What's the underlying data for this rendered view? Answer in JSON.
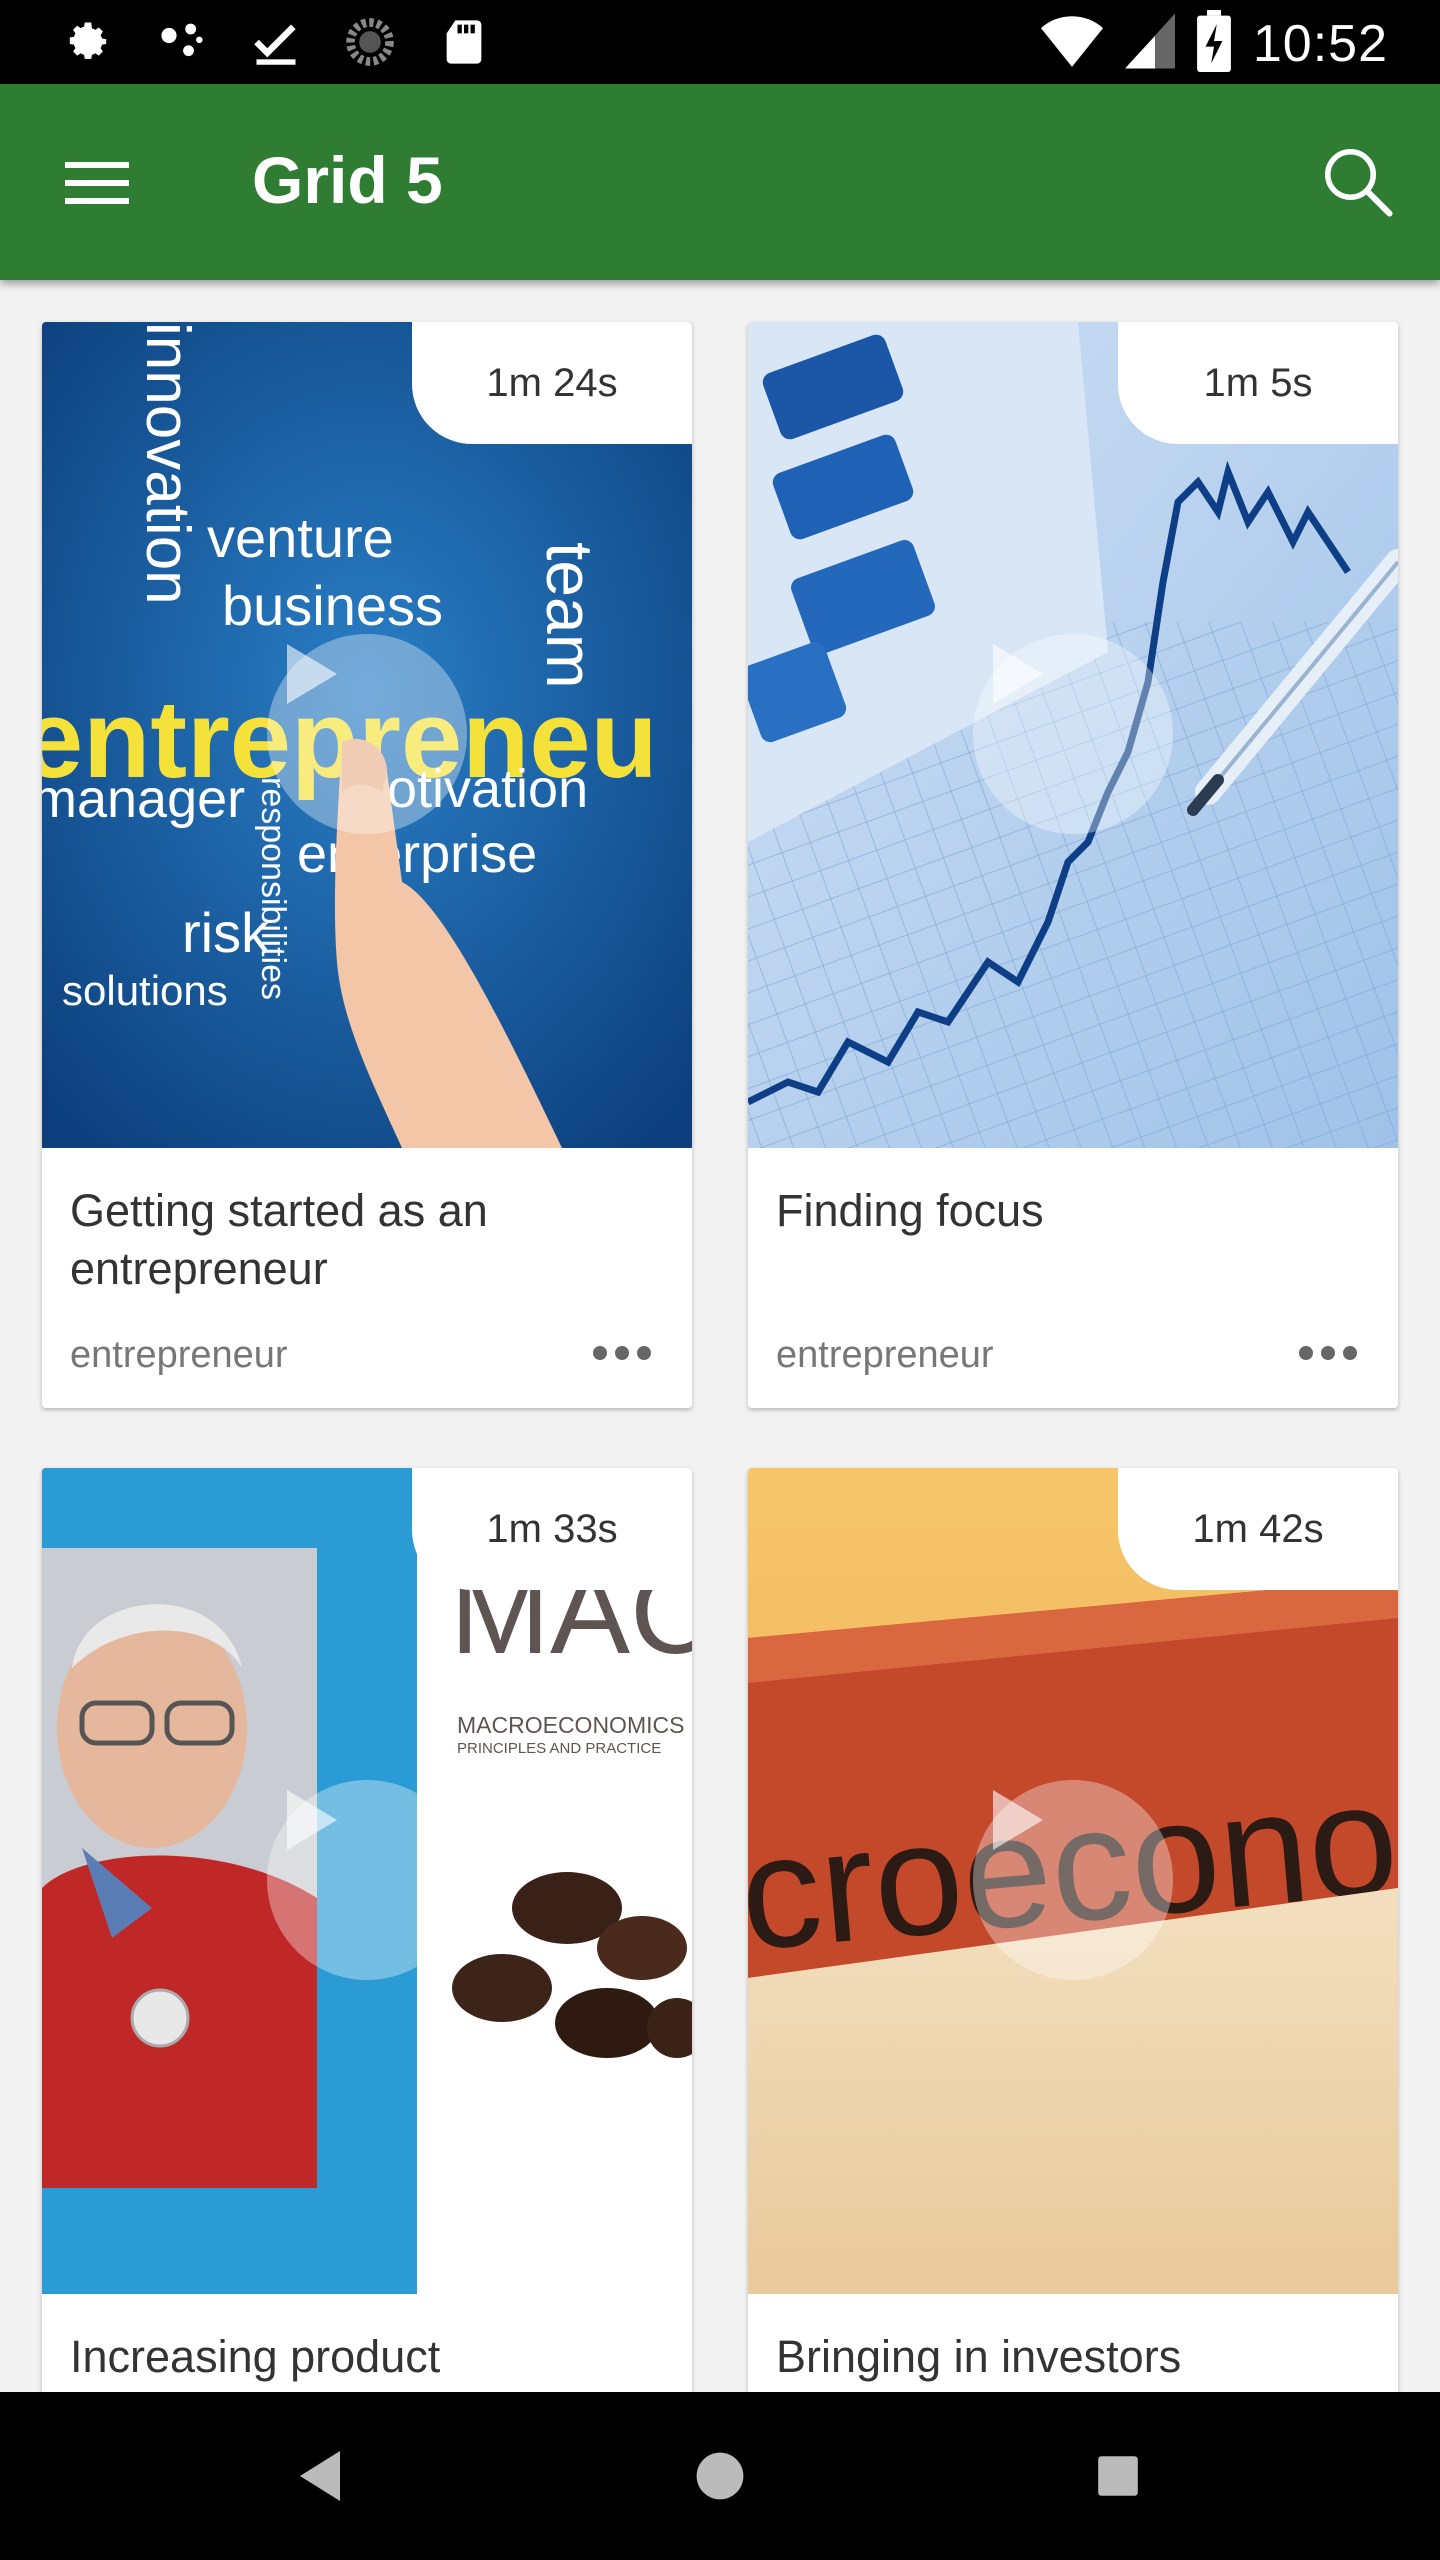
{
  "status_bar": {
    "time": "10:52",
    "left_icons": [
      "settings-icon",
      "dots-network-icon",
      "download-check-icon",
      "sync-spinner-icon",
      "sd-card-icon"
    ],
    "right_icons": [
      "wifi-icon",
      "cellular-signal-icon",
      "battery-charging-icon"
    ]
  },
  "app_bar": {
    "title": "Grid 5",
    "menu_icon": "hamburger-menu-icon",
    "search_icon": "search-icon"
  },
  "colors": {
    "app_bar": "#2e7d32",
    "background": "#f2f2f2",
    "card": "#ffffff"
  },
  "cards": [
    {
      "title": "Getting started as an entrepreneur",
      "tag": "entrepreneur",
      "duration": "1m 24s",
      "thumb_words": [
        "innovation",
        "venture",
        "business",
        "team",
        "entrepreneu",
        "manager",
        "motivation",
        "enterprise",
        "risk",
        "solutions",
        "responsibilities"
      ]
    },
    {
      "title": "Finding focus",
      "tag": "entrepreneur",
      "duration": "1m 5s",
      "thumb_words": []
    },
    {
      "title": "Increasing product",
      "tag": "",
      "duration": "1m 33s",
      "thumb_words": [
        "MAC",
        "MACROECONOMICS",
        "PRINCIPLES AND PRACTICE"
      ]
    },
    {
      "title": "Bringing in investors",
      "tag": "",
      "duration": "1m 42s",
      "thumb_words": [
        "croeconom"
      ]
    }
  ],
  "nav_bar": {
    "buttons": [
      "back-icon",
      "home-icon",
      "recents-icon"
    ]
  }
}
